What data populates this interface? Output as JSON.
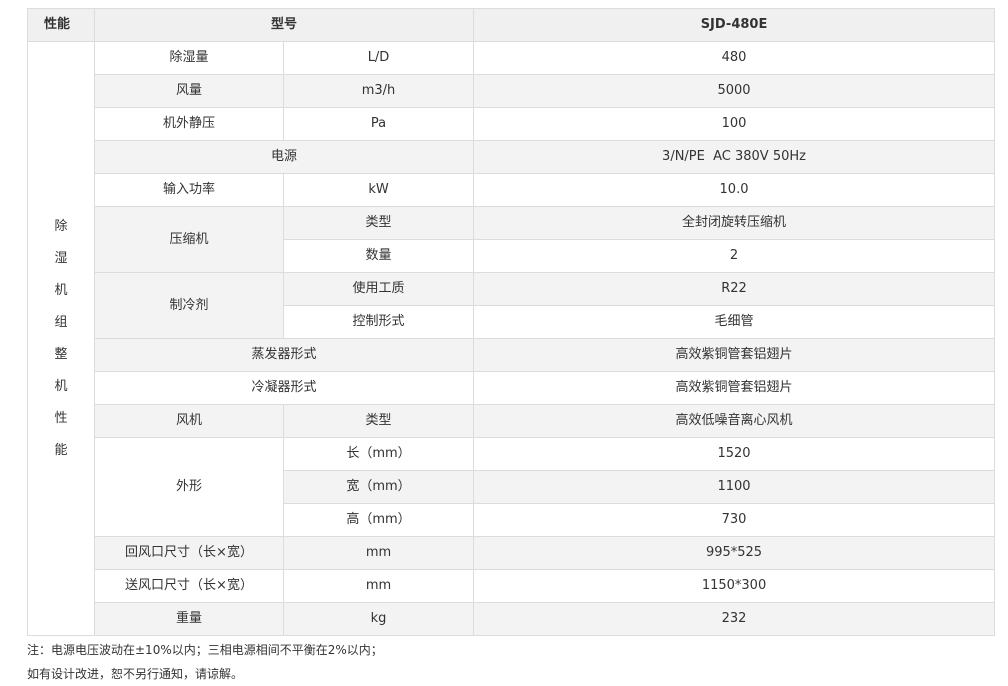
{
  "header": {
    "performance": "性能",
    "model": "型号",
    "model_value": "SJD-480E"
  },
  "group_label": "除湿机组整机性能",
  "rows": {
    "dehumid": {
      "name": "除湿量",
      "unit": "L/D",
      "value": "480"
    },
    "airflow": {
      "name": "风量",
      "unit": "m3/h",
      "value": "5000"
    },
    "static_pressure": {
      "name": "机外静压",
      "unit": "Pa",
      "value": "100"
    },
    "power_supply": {
      "name": "电源",
      "value": "3/N/PE  AC 380V 50Hz"
    },
    "input_power": {
      "name": "输入功率",
      "unit": "kW",
      "value": "10.0"
    },
    "compressor": {
      "name": "压缩机",
      "type": {
        "label": "类型",
        "value": "全封闭旋转压缩机"
      },
      "count": {
        "label": "数量",
        "value": "2"
      }
    },
    "refrigerant": {
      "name": "制冷剂",
      "medium": {
        "label": "使用工质",
        "value": "R22"
      },
      "control": {
        "label": "控制形式",
        "value": "毛细管"
      }
    },
    "evaporator": {
      "name": "蒸发器形式",
      "value": "高效紫铜管套铝翅片"
    },
    "condenser": {
      "name": "冷凝器形式",
      "value": "高效紫铜管套铝翅片"
    },
    "fan": {
      "name": "风机",
      "type_label": "类型",
      "value": "高效低噪音离心风机"
    },
    "dimensions": {
      "name": "外形",
      "length": {
        "label": "长（mm）",
        "value": "1520"
      },
      "width": {
        "label": "宽（mm）",
        "value": "1100"
      },
      "height": {
        "label": "高（mm）",
        "value": "730"
      }
    },
    "return_air": {
      "name": "回风口尺寸（长×宽）",
      "unit": "mm",
      "value": "995*525"
    },
    "supply_air": {
      "name": "送风口尺寸（长×宽）",
      "unit": "mm",
      "value": "1150*300"
    },
    "weight": {
      "name": "重量",
      "unit": "kg",
      "value": "232"
    }
  },
  "notes": {
    "line1": "注：电源电压波动在±10%以内；三相电源相间不平衡在2%以内；",
    "line2": "如有设计改进，恕不另行通知，请谅解。"
  }
}
